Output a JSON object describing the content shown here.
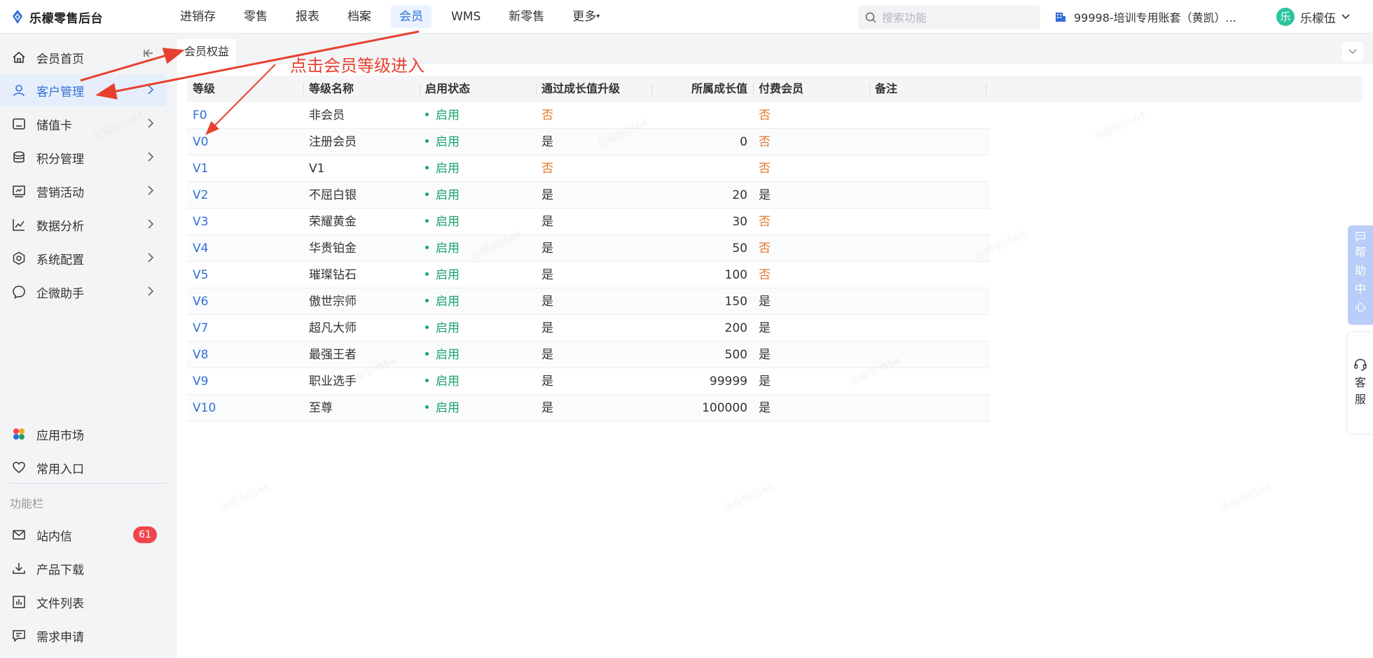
{
  "app": {
    "logo_text": "乐檬零售后台",
    "brand_color": "#2f6fd6"
  },
  "topnav": {
    "items": [
      "进销存",
      "零售",
      "报表",
      "档案",
      "会员",
      "WMS",
      "新零售",
      "更多"
    ],
    "active": "会员"
  },
  "search": {
    "placeholder": "搜索功能",
    "value": ""
  },
  "account": {
    "label": "99998-培训专用账套（黄凯）..."
  },
  "user": {
    "avatar_char": "乐",
    "name": "乐檬伍"
  },
  "sidebar": {
    "items": [
      {
        "label": "会员首页",
        "icon": "home-icon"
      },
      {
        "label": "客户管理",
        "icon": "user-icon",
        "active": true
      },
      {
        "label": "储值卡",
        "icon": "card-icon"
      },
      {
        "label": "积分管理",
        "icon": "coins-icon"
      },
      {
        "label": "营销活动",
        "icon": "marketing-icon"
      },
      {
        "label": "数据分析",
        "icon": "chart-icon"
      },
      {
        "label": "系统配置",
        "icon": "settings-icon"
      },
      {
        "label": "企微助手",
        "icon": "chat-icon"
      }
    ],
    "bottom_items": [
      {
        "label": "应用市场",
        "icon": "app-market-icon"
      },
      {
        "label": "常用入口",
        "icon": "heart-icon"
      }
    ],
    "section_label": "功能栏",
    "function_items": [
      {
        "label": "站内信",
        "icon": "mail-icon",
        "badge": "61"
      },
      {
        "label": "产品下载",
        "icon": "download-icon"
      },
      {
        "label": "文件列表",
        "icon": "file-list-icon"
      },
      {
        "label": "需求申请",
        "icon": "request-icon"
      }
    ]
  },
  "tab": {
    "label": "会员权益"
  },
  "table": {
    "headers": [
      "等级",
      "等级名称",
      "启用状态",
      "通过成长值升级",
      "所属成长值",
      "付费会员",
      "备注"
    ],
    "rows": [
      {
        "level": "F0",
        "name": "非会员",
        "status": "启用",
        "upgrade": "否",
        "growth": "",
        "paid": "否",
        "note": ""
      },
      {
        "level": "V0",
        "name": "注册会员",
        "status": "启用",
        "upgrade": "是",
        "growth": "0",
        "paid": "否",
        "note": ""
      },
      {
        "level": "V1",
        "name": "V1",
        "status": "启用",
        "upgrade": "否",
        "growth": "",
        "paid": "否",
        "note": ""
      },
      {
        "level": "V2",
        "name": "不屈白银",
        "status": "启用",
        "upgrade": "是",
        "growth": "20",
        "paid": "是",
        "note": ""
      },
      {
        "level": "V3",
        "name": "荣耀黄金",
        "status": "启用",
        "upgrade": "是",
        "growth": "30",
        "paid": "否",
        "note": ""
      },
      {
        "level": "V4",
        "name": "华贵铂金",
        "status": "启用",
        "upgrade": "是",
        "growth": "50",
        "paid": "否",
        "note": ""
      },
      {
        "level": "V5",
        "name": "璀璨钻石",
        "status": "启用",
        "upgrade": "是",
        "growth": "100",
        "paid": "否",
        "note": ""
      },
      {
        "level": "V6",
        "name": "傲世宗师",
        "status": "启用",
        "upgrade": "是",
        "growth": "150",
        "paid": "是",
        "note": ""
      },
      {
        "level": "V7",
        "name": "超凡大师",
        "status": "启用",
        "upgrade": "是",
        "growth": "200",
        "paid": "是",
        "note": ""
      },
      {
        "level": "V8",
        "name": "最强王者",
        "status": "启用",
        "upgrade": "是",
        "growth": "500",
        "paid": "是",
        "note": ""
      },
      {
        "level": "V9",
        "name": "职业选手",
        "status": "启用",
        "upgrade": "是",
        "growth": "99999",
        "paid": "是",
        "note": ""
      },
      {
        "level": "V10",
        "name": "至尊",
        "status": "启用",
        "upgrade": "是",
        "growth": "100000",
        "paid": "是",
        "note": ""
      }
    ]
  },
  "right_float": {
    "help_chars": [
      "帮",
      "助",
      "中",
      "心"
    ],
    "service_chars": [
      "客",
      "服"
    ]
  },
  "annotation": {
    "text": "点击会员等级进入",
    "color": "#e8402f"
  },
  "colors": {
    "status_green": "#1aa36b",
    "no_orange": "#e8782c",
    "badge_red": "#f0454c",
    "help_blue": "#b8cdf8"
  }
}
